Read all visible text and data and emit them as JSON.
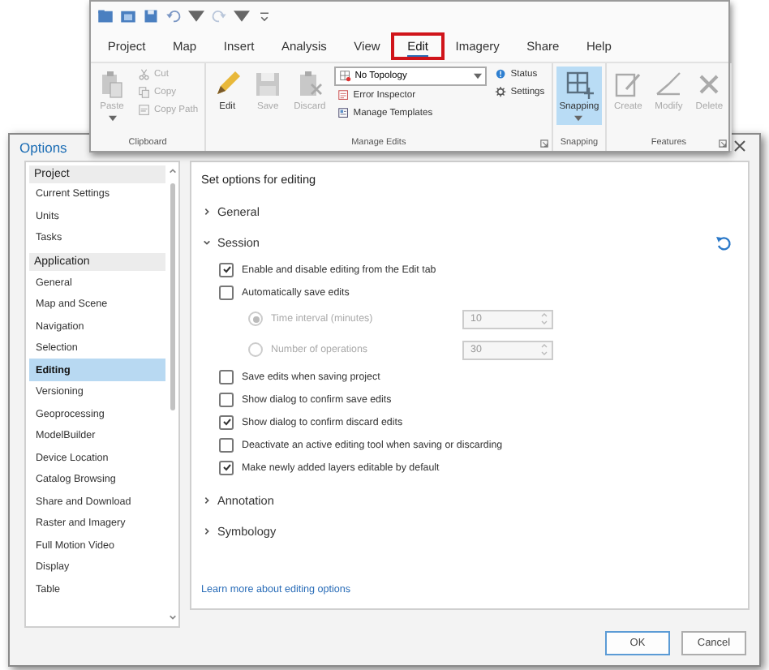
{
  "ribbon": {
    "tabs": [
      {
        "label": "Project",
        "selected": false,
        "outlined": false
      },
      {
        "label": "Map",
        "selected": false,
        "outlined": false
      },
      {
        "label": "Insert",
        "selected": false,
        "outlined": false
      },
      {
        "label": "Analysis",
        "selected": false,
        "outlined": false
      },
      {
        "label": "View",
        "selected": false,
        "outlined": false
      },
      {
        "label": "Edit",
        "selected": true,
        "outlined": true
      },
      {
        "label": "Imagery",
        "selected": false,
        "outlined": false
      },
      {
        "label": "Share",
        "selected": false,
        "outlined": false
      },
      {
        "label": "Help",
        "selected": false,
        "outlined": false
      }
    ],
    "groups": [
      {
        "label": "Clipboard",
        "launcher": false,
        "columns": [
          [
            {
              "kind": "large",
              "label": "Paste",
              "disabled": true,
              "selected": false,
              "menu": true
            }
          ],
          [
            {
              "kind": "small",
              "label": "Cut",
              "disabled": true,
              "selected": false,
              "menu": false
            },
            {
              "kind": "small",
              "label": "Copy",
              "disabled": true,
              "selected": false,
              "menu": false
            },
            {
              "kind": "small",
              "label": "Copy Path",
              "disabled": true,
              "selected": false,
              "menu": false
            }
          ]
        ]
      },
      {
        "label": "Manage Edits",
        "launcher": true,
        "columns": [
          [
            {
              "kind": "large",
              "label": "Edit",
              "disabled": false,
              "selected": false,
              "menu": false
            }
          ],
          [
            {
              "kind": "large",
              "label": "Save",
              "disabled": true,
              "selected": false,
              "menu": false
            }
          ],
          [
            {
              "kind": "large",
              "label": "Discard",
              "disabled": true,
              "selected": false,
              "menu": false
            }
          ],
          [
            {
              "kind": "dropdown",
              "label": "No Topology",
              "disabled": false,
              "selected": false,
              "menu": true
            },
            {
              "kind": "small",
              "label": "Error Inspector",
              "disabled": false,
              "selected": false,
              "menu": false
            },
            {
              "kind": "small",
              "label": "Manage Templates",
              "disabled": false,
              "selected": false,
              "menu": false
            }
          ],
          [
            {
              "kind": "small",
              "label": "Status",
              "disabled": false,
              "selected": false,
              "menu": false
            },
            {
              "kind": "small",
              "label": "Settings",
              "disabled": false,
              "selected": false,
              "menu": false
            }
          ]
        ]
      },
      {
        "label": "Snapping",
        "launcher": false,
        "columns": [
          [
            {
              "kind": "large",
              "label": "Snapping",
              "disabled": false,
              "selected": true,
              "menu": true
            }
          ]
        ]
      },
      {
        "label": "Features",
        "launcher": true,
        "columns": [
          [
            {
              "kind": "large",
              "label": "Create",
              "disabled": true,
              "selected": false,
              "menu": false
            }
          ],
          [
            {
              "kind": "large",
              "label": "Modify",
              "disabled": true,
              "selected": false,
              "menu": false
            }
          ],
          [
            {
              "kind": "large",
              "label": "Delete",
              "disabled": true,
              "selected": false,
              "menu": false
            }
          ]
        ]
      }
    ]
  },
  "dialog": {
    "title": "Options",
    "sidebar": [
      {
        "heading": "Project",
        "items": [
          {
            "label": "Current Settings",
            "selected": false
          },
          {
            "label": "Units",
            "selected": false
          },
          {
            "label": "Tasks",
            "selected": false
          }
        ]
      },
      {
        "heading": "Application",
        "items": [
          {
            "label": "General",
            "selected": false
          },
          {
            "label": "Map and Scene",
            "selected": false
          },
          {
            "label": "Navigation",
            "selected": false
          },
          {
            "label": "Selection",
            "selected": false
          },
          {
            "label": "Editing",
            "selected": true
          },
          {
            "label": "Versioning",
            "selected": false
          },
          {
            "label": "Geoprocessing",
            "selected": false
          },
          {
            "label": "ModelBuilder",
            "selected": false
          },
          {
            "label": "Device Location",
            "selected": false
          },
          {
            "label": "Catalog Browsing",
            "selected": false
          },
          {
            "label": "Share and Download",
            "selected": false
          },
          {
            "label": "Raster and Imagery",
            "selected": false
          },
          {
            "label": "Full Motion Video",
            "selected": false
          },
          {
            "label": "Display",
            "selected": false
          },
          {
            "label": "Table",
            "selected": false
          }
        ]
      }
    ],
    "content": {
      "heading": "Set options for editing",
      "sections": [
        {
          "label": "General",
          "expanded": false
        },
        {
          "label": "Session",
          "expanded": true,
          "options": [
            {
              "kind": "checkbox",
              "label": "Enable and disable editing from the Edit tab",
              "checked": true,
              "disabled": false
            },
            {
              "kind": "checkbox",
              "label": "Automatically save edits",
              "checked": false,
              "disabled": false
            },
            {
              "kind": "radio",
              "label": "Time interval (minutes)",
              "checked": true,
              "disabled": true,
              "value": "10"
            },
            {
              "kind": "radio",
              "label": "Number of operations",
              "checked": false,
              "disabled": true,
              "value": "30"
            },
            {
              "kind": "checkbox",
              "label": "Save edits when saving project",
              "checked": false,
              "disabled": false
            },
            {
              "kind": "checkbox",
              "label": "Show dialog to confirm save edits",
              "checked": false,
              "disabled": false
            },
            {
              "kind": "checkbox",
              "label": "Show dialog to confirm discard edits",
              "checked": true,
              "disabled": false
            },
            {
              "kind": "checkbox",
              "label": "Deactivate an active editing tool when saving or discarding",
              "checked": false,
              "disabled": false
            },
            {
              "kind": "checkbox",
              "label": "Make newly added layers editable by default",
              "checked": true,
              "disabled": false
            }
          ]
        },
        {
          "label": "Annotation",
          "expanded": false
        },
        {
          "label": "Symbology",
          "expanded": false
        }
      ],
      "link": "Learn more about editing options"
    },
    "buttons": [
      {
        "label": "OK",
        "default": true
      },
      {
        "label": "Cancel",
        "default": false
      }
    ]
  }
}
